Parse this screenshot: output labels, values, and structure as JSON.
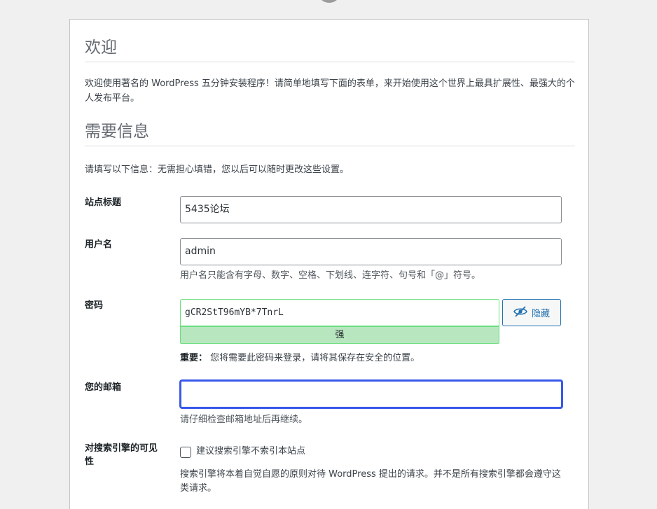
{
  "welcome": {
    "heading": "欢迎",
    "text": "欢迎使用著名的 WordPress 五分钟安装程序！请简单地填写下面的表单，来开始使用这个世界上最具扩展性、最强大的个人发布平台。"
  },
  "info": {
    "heading": "需要信息",
    "text": "请填写以下信息：无需担心填错，您以后可以随时更改这些设置。"
  },
  "form": {
    "site_title": {
      "label": "站点标题",
      "value": "5435论坛"
    },
    "username": {
      "label": "用户名",
      "value": "admin",
      "hint": "用户名只能含有字母、数字、空格、下划线、连字符、句号和「@」符号。"
    },
    "password": {
      "label": "密码",
      "value": "gCR2StT96mYB*7TnrL",
      "strength": "强",
      "toggle_label": "隐藏",
      "note_lead": "重要：",
      "note": "您将需要此密码来登录，请将其保存在安全的位置。"
    },
    "email": {
      "label": "您的邮箱",
      "value": "",
      "hint": "请仔细检查邮箱地址后再继续。"
    },
    "search_visibility": {
      "label": "对搜索引擎的可见性",
      "checkbox_label": "建议搜索引擎不索引本站点",
      "checked": false,
      "desc": "搜索引擎将本着自觉自愿的原则对待 WordPress 提出的请求。并不是所有搜索引擎都会遵守这类请求。"
    }
  },
  "colors": {
    "focus_border": "#3858e9",
    "strength_bg": "#b8e6bf",
    "strength_border": "#68de7c",
    "button_blue": "#2271b1"
  }
}
